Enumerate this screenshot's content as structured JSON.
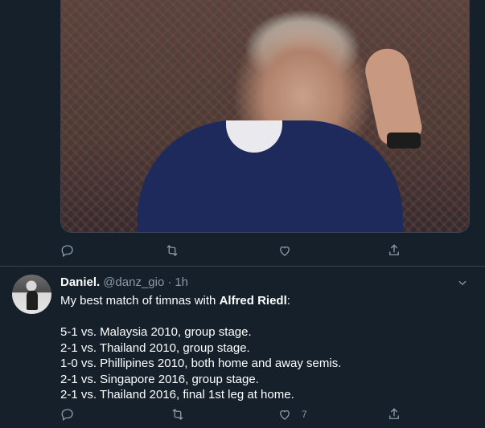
{
  "tweet1": {
    "image_alt_semantic": "photo",
    "actions": {
      "reply": "",
      "retweet": "",
      "like": "",
      "share": ""
    }
  },
  "tweet2": {
    "author": {
      "name": "Daniel.",
      "handle": "@danz_gio",
      "separator": "·",
      "time": "1h"
    },
    "text": {
      "intro_prefix": "My best match of timnas with ",
      "intro_highlight": "Alfred Riedl",
      "intro_suffix": ":",
      "lines": [
        "5-1 vs. Malaysia 2010, group stage.",
        "2-1 vs. Thailand 2010, group stage.",
        "1-0 vs. Phillipines 2010, both home and away semis.",
        "2-1 vs. Singapore 2016, group stage.",
        "2-1 vs. Thailand 2016, final 1st leg at home."
      ]
    },
    "actions": {
      "like_count": "7"
    }
  },
  "colors": {
    "background": "#15202b",
    "divider": "#38444d",
    "muted": "#8899a6",
    "text": "#ffffff"
  },
  "icons": [
    "reply-icon",
    "retweet-icon",
    "like-icon",
    "share-icon",
    "chevron-down-icon"
  ]
}
